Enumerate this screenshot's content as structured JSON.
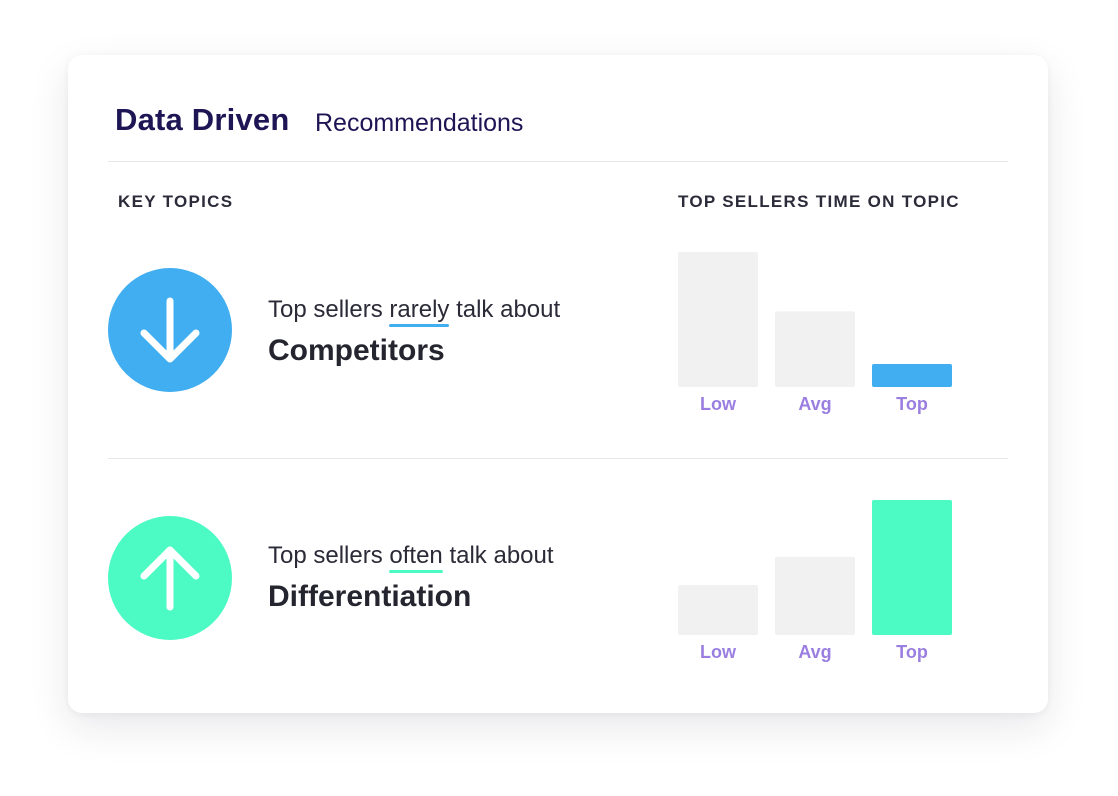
{
  "header": {
    "title": "Data Driven",
    "subtitle": "Recommendations"
  },
  "columns": {
    "left": "KEY TOPICS",
    "right": "TOP SELLERS TIME ON TOPIC"
  },
  "rows": [
    {
      "icon": "arrow-down-icon",
      "color": "#40aef0",
      "prefix": "Top sellers ",
      "keyword": "rarely",
      "suffix": " talk about",
      "topic": "Competitors"
    },
    {
      "icon": "arrow-up-icon",
      "color": "#4cfac4",
      "prefix": "Top sellers ",
      "keyword": "often",
      "suffix": " talk about",
      "topic": "Differentiation"
    }
  ],
  "colors": {
    "bar_neutral": "#f1f1f1",
    "tick_label": "#9a7fe0"
  },
  "chart_data": [
    {
      "type": "bar",
      "categories": [
        "Low",
        "Avg",
        "Top"
      ],
      "values": [
        100,
        56,
        17
      ],
      "highlight": "Top",
      "highlight_color": "#40aef0",
      "ylim": [
        0,
        100
      ]
    },
    {
      "type": "bar",
      "categories": [
        "Low",
        "Avg",
        "Top"
      ],
      "values": [
        37,
        58,
        100
      ],
      "highlight": "Top",
      "highlight_color": "#4cfac4",
      "ylim": [
        0,
        100
      ]
    }
  ]
}
